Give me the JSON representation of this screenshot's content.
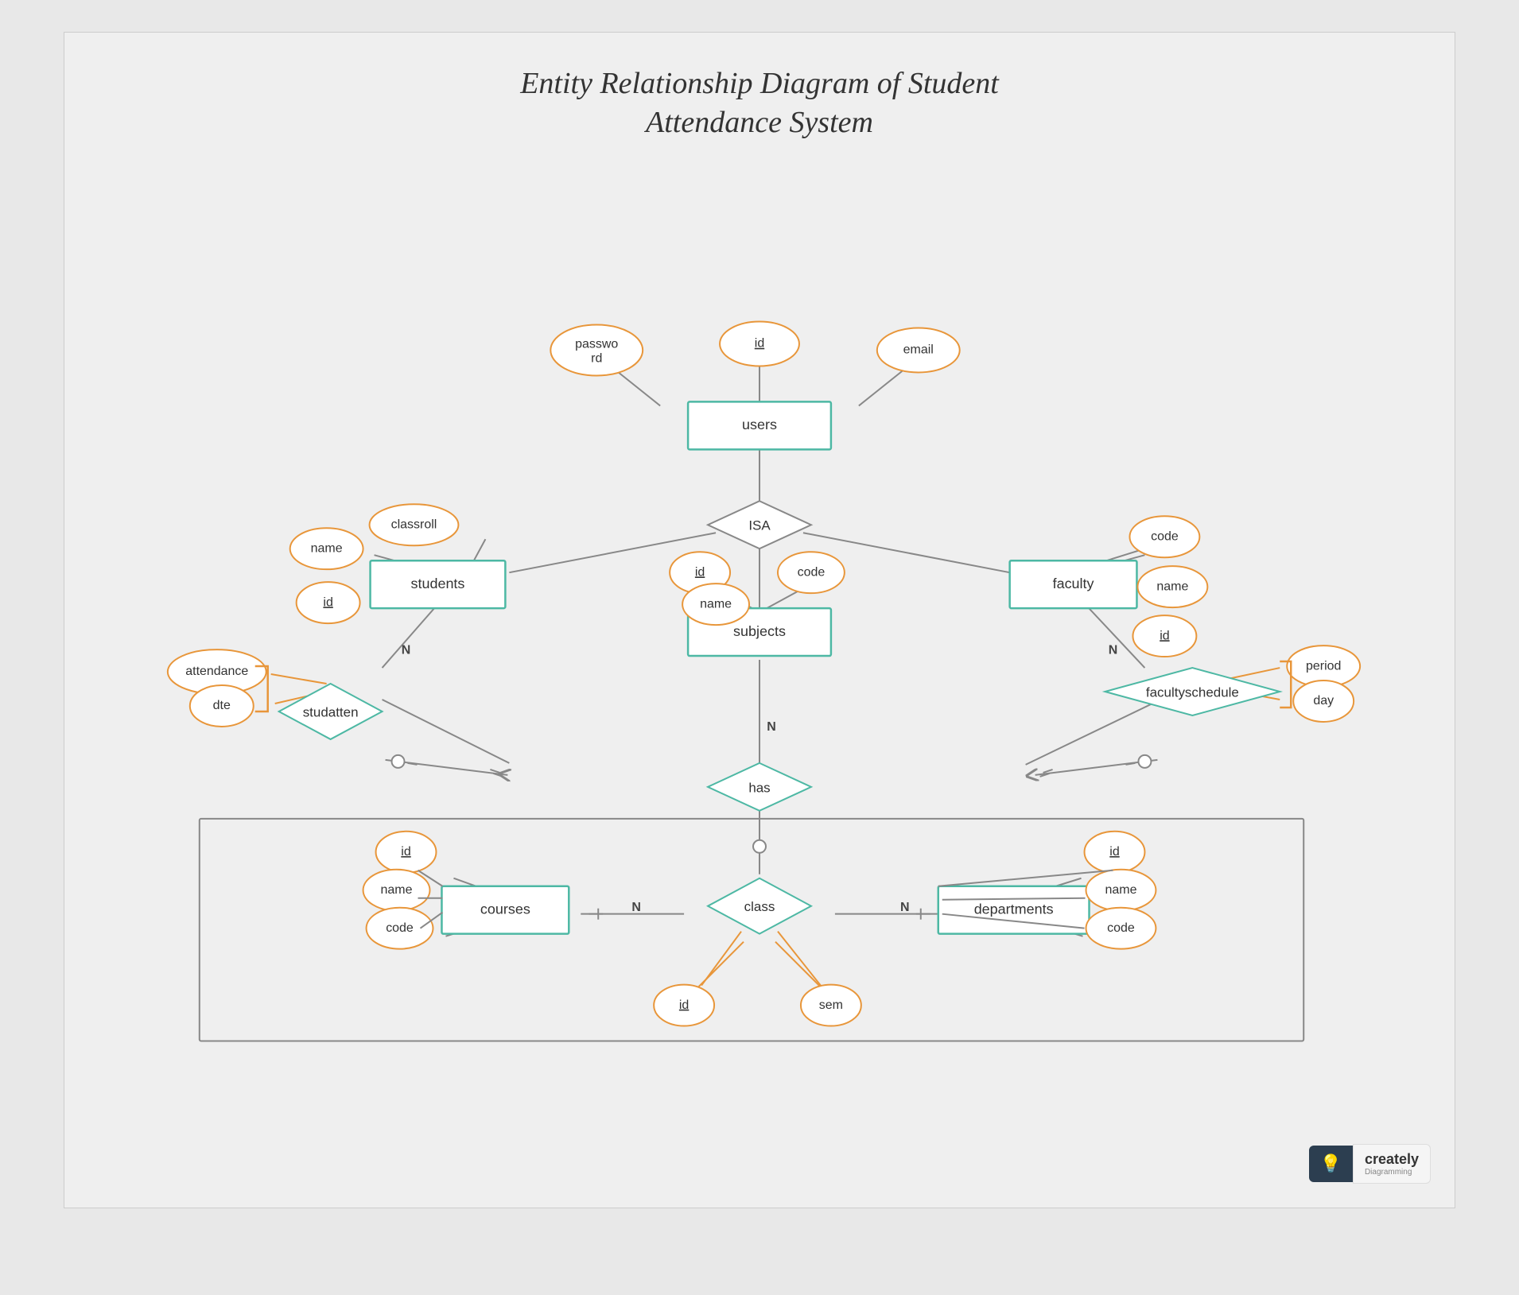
{
  "title": {
    "line1": "Entity Relationship Diagram of Student",
    "line2": "Attendance System"
  },
  "entities": [
    {
      "id": "users",
      "label": "users"
    },
    {
      "id": "students",
      "label": "students"
    },
    {
      "id": "faculty",
      "label": "faculty"
    },
    {
      "id": "subjects",
      "label": "subjects"
    },
    {
      "id": "courses",
      "label": "courses"
    },
    {
      "id": "departments",
      "label": "departments"
    }
  ],
  "relationships": [
    {
      "id": "isa",
      "label": "ISA"
    },
    {
      "id": "studatten",
      "label": "studatten"
    },
    {
      "id": "facultyschedule",
      "label": "facultyschedule"
    },
    {
      "id": "has",
      "label": "has"
    },
    {
      "id": "class",
      "label": "class"
    }
  ],
  "attributes": [
    {
      "id": "users_id",
      "label": "id",
      "underline": true
    },
    {
      "id": "users_password",
      "label": "passwo\nrd"
    },
    {
      "id": "users_email",
      "label": "email"
    },
    {
      "id": "students_name",
      "label": "name"
    },
    {
      "id": "students_classroll",
      "label": "classroll"
    },
    {
      "id": "students_id",
      "label": "id",
      "underline": true
    },
    {
      "id": "faculty_code",
      "label": "code"
    },
    {
      "id": "faculty_name",
      "label": "name"
    },
    {
      "id": "faculty_id",
      "label": "id",
      "underline": true
    },
    {
      "id": "subjects_id",
      "label": "id",
      "underline": true
    },
    {
      "id": "subjects_name",
      "label": "name"
    },
    {
      "id": "subjects_code",
      "label": "code"
    },
    {
      "id": "studatten_attendance",
      "label": "attendance"
    },
    {
      "id": "studatten_dte",
      "label": "dte"
    },
    {
      "id": "facultyschedule_period",
      "label": "period"
    },
    {
      "id": "facultyschedule_day",
      "label": "day"
    },
    {
      "id": "courses_id",
      "label": "id",
      "underline": true
    },
    {
      "id": "courses_name",
      "label": "name"
    },
    {
      "id": "courses_code",
      "label": "code"
    },
    {
      "id": "departments_id",
      "label": "id",
      "underline": true
    },
    {
      "id": "departments_name",
      "label": "name"
    },
    {
      "id": "departments_code",
      "label": "code"
    },
    {
      "id": "class_id",
      "label": "id",
      "underline": true
    },
    {
      "id": "class_sem",
      "label": "sem"
    }
  ],
  "logo": {
    "brand": "creately",
    "sub": "Diagramming"
  }
}
